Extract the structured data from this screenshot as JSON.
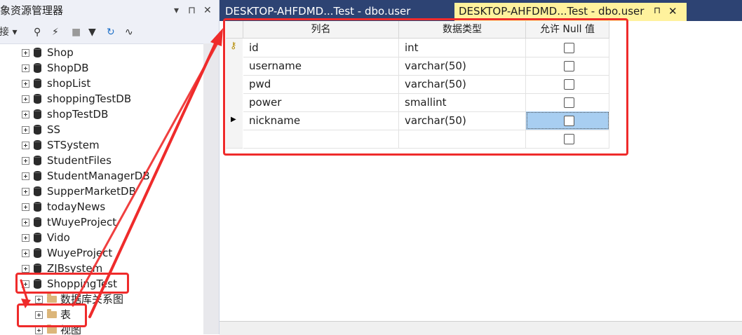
{
  "explorer": {
    "title": "对象资源管理器",
    "title_controls": {
      "pin": "▾ ⊓",
      "close": "✕"
    },
    "connect_label": "连接",
    "tree": [
      {
        "label": "Shop",
        "kind": "db"
      },
      {
        "label": "ShopDB",
        "kind": "db"
      },
      {
        "label": "shopList",
        "kind": "db"
      },
      {
        "label": "shoppingTestDB",
        "kind": "db"
      },
      {
        "label": "shopTestDB",
        "kind": "db"
      },
      {
        "label": "SS",
        "kind": "db"
      },
      {
        "label": "STSystem",
        "kind": "db"
      },
      {
        "label": "StudentFiles",
        "kind": "db"
      },
      {
        "label": "StudentManagerDB",
        "kind": "db"
      },
      {
        "label": "SupperMarketDB",
        "kind": "db"
      },
      {
        "label": "todayNews",
        "kind": "db"
      },
      {
        "label": "tWuyeProject",
        "kind": "db"
      },
      {
        "label": "Vido",
        "kind": "db"
      },
      {
        "label": "WuyeProject",
        "kind": "db"
      },
      {
        "label": "ZJBsystem",
        "kind": "db"
      },
      {
        "label": "ShoppingTest",
        "kind": "db"
      },
      {
        "label": "数据库关系图",
        "kind": "folder"
      },
      {
        "label": "表",
        "kind": "folder"
      },
      {
        "label": "视图",
        "kind": "folder"
      }
    ]
  },
  "tabs": [
    {
      "label": "DESKTOP-AHFDMD...Test - dbo.user",
      "active": false
    },
    {
      "label": "DESKTOP-AHFDMD...Test - dbo.user",
      "active": true
    }
  ],
  "tab_controls": {
    "pin": "⊓",
    "close": "✕"
  },
  "grid": {
    "columns": [
      "列名",
      "数据类型",
      "允许 Null 值"
    ],
    "rows": [
      {
        "name": "id",
        "type": "int",
        "allow_null": false,
        "primary_key": true
      },
      {
        "name": "username",
        "type": "varchar(50)",
        "allow_null": false
      },
      {
        "name": "pwd",
        "type": "varchar(50)",
        "allow_null": false
      },
      {
        "name": "power",
        "type": "smallint",
        "allow_null": false
      },
      {
        "name": "nickname",
        "type": "varchar(50)",
        "allow_null": false,
        "current": true
      },
      {
        "name": "",
        "type": "",
        "allow_null": false
      }
    ]
  },
  "colors": {
    "tab_bar": "#2d4373",
    "active_tab": "#fff29d",
    "annotation": "#ef2b2b",
    "selected_cell": "#a8cef1"
  }
}
